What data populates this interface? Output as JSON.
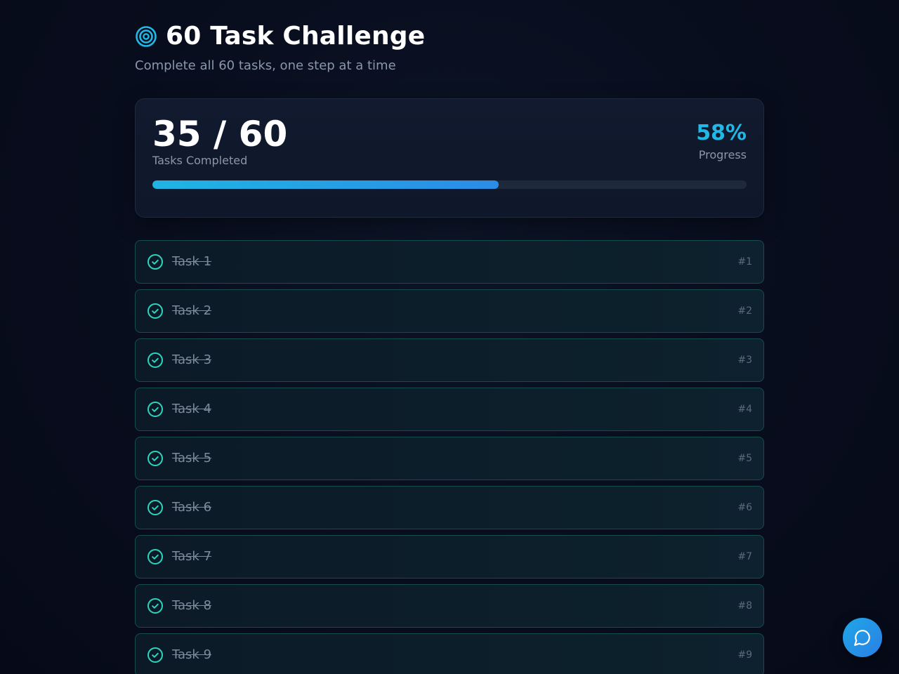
{
  "header": {
    "icon": "target-icon",
    "title": "60 Task Challenge",
    "subtitle": "Complete all 60 tasks, one step at a time"
  },
  "progress": {
    "count_text": "35 / 60",
    "count_label": "Tasks Completed",
    "percent_text": "58%",
    "percent_label": "Progress",
    "fraction": 0.5833
  },
  "colors": {
    "accent": "#22b8e6",
    "check": "#2dd4bf",
    "task_border": "#134e4a"
  },
  "tasks": [
    {
      "label": "Task 1",
      "num": "#1",
      "done": true
    },
    {
      "label": "Task 2",
      "num": "#2",
      "done": true
    },
    {
      "label": "Task 3",
      "num": "#3",
      "done": true
    },
    {
      "label": "Task 4",
      "num": "#4",
      "done": true
    },
    {
      "label": "Task 5",
      "num": "#5",
      "done": true
    },
    {
      "label": "Task 6",
      "num": "#6",
      "done": true
    },
    {
      "label": "Task 7",
      "num": "#7",
      "done": true
    },
    {
      "label": "Task 8",
      "num": "#8",
      "done": true
    },
    {
      "label": "Task 9",
      "num": "#9",
      "done": true
    }
  ],
  "chat": {
    "icon": "chat-bubble-icon"
  }
}
